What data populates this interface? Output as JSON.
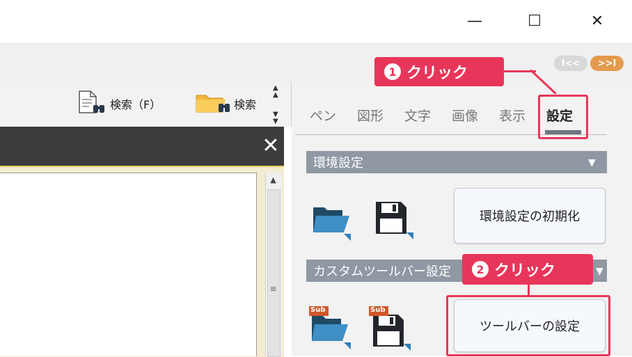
{
  "window": {
    "minimize_glyph": "—",
    "maximize_glyph": "☐",
    "close_glyph": "✕"
  },
  "pager": {
    "prev": "I<<",
    "next": ">>I"
  },
  "toolbar": {
    "search_label": "検索（F）",
    "search_folder_label": "検索"
  },
  "panel": {
    "close_glyph": "✕"
  },
  "tabs": [
    {
      "label": "ペン"
    },
    {
      "label": "図形"
    },
    {
      "label": "文字"
    },
    {
      "label": "画像"
    },
    {
      "label": "表示"
    },
    {
      "label": "設定"
    }
  ],
  "sections": {
    "env": {
      "title": "環境設定",
      "reset_button": "環境設定の初期化"
    },
    "toolbar": {
      "title": "カスタムツールバー設定",
      "settings_button": "ツールバーの設定"
    }
  },
  "badges": {
    "sub": "Sub"
  },
  "callouts": {
    "first": {
      "num": "1",
      "text": "クリック"
    },
    "second": {
      "num": "2",
      "text": "クリック"
    }
  },
  "colors": {
    "accent": "#e8365a",
    "section_header": "#8f98a3",
    "panel_dark": "#3c3c3c"
  },
  "icons": [
    "folder-open-icon",
    "save-disk-icon",
    "document-search-icon",
    "folder-search-icon"
  ]
}
